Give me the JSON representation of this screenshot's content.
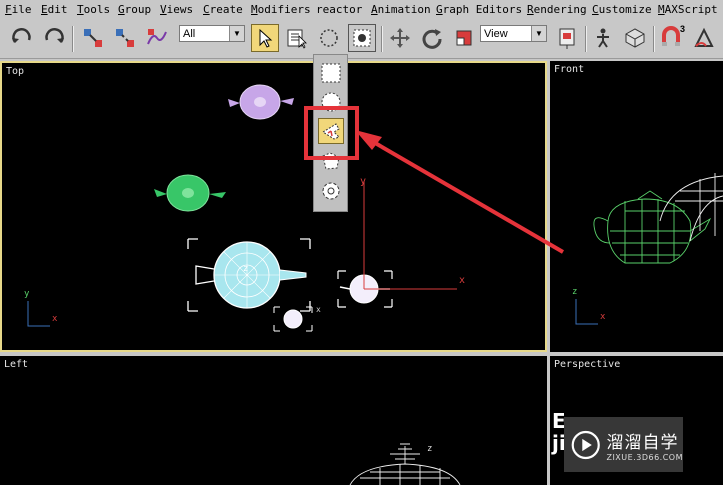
{
  "menu": {
    "items": [
      {
        "label": "File",
        "ul": "F"
      },
      {
        "label": "Edit",
        "ul": "E"
      },
      {
        "label": "Tools",
        "ul": "T"
      },
      {
        "label": "Group",
        "ul": "G"
      },
      {
        "label": "Views",
        "ul": "V"
      },
      {
        "label": "Create",
        "ul": "C"
      },
      {
        "label": "Modifiers",
        "ul": "M"
      },
      {
        "label": "reactor",
        "ul": ""
      },
      {
        "label": "Animation",
        "ul": "A"
      },
      {
        "label": "Graph Editors",
        "ul": "G"
      },
      {
        "label": "Rendering",
        "ul": "R"
      },
      {
        "label": "Customize",
        "ul": "C"
      },
      {
        "label": "MAXScript",
        "ul": "M"
      }
    ]
  },
  "toolbar": {
    "filter_value": "All",
    "coord_value": "View",
    "icons": [
      "undo-icon",
      "redo-icon",
      "select-and-link-icon",
      "unlink-icon",
      "bind-space-warp-icon",
      "select-object-icon",
      "select-by-name-icon",
      "selection-region-icon",
      "window-crossing-icon",
      "move-icon",
      "rotate-icon",
      "scale-icon",
      "pivot-center-icon",
      "manipulate-icon",
      "keyboard-shortcut-icon",
      "snaps-toggle-icon",
      "angle-snap-icon"
    ],
    "snap_label": "3"
  },
  "viewports": {
    "top": {
      "label": "Top"
    },
    "front": {
      "label": "Front"
    },
    "left": {
      "label": "Left"
    },
    "perspective": {
      "label": "Perspective"
    }
  },
  "axes": {
    "x": "x",
    "y": "y",
    "z": "z"
  },
  "flyout": {
    "items": [
      "rectangular-region-icon",
      "circular-region-icon",
      "lasso-region-icon",
      "fence-region-icon",
      "paint-region-icon"
    ],
    "selected": "lasso-region-icon"
  },
  "colors": {
    "highlight_border": "#e7d98a",
    "annotation_red": "#e5333a",
    "teapot_purple": "#c7a6e8",
    "teapot_green": "#38c668",
    "teapot_cyan": "#a8e6ee",
    "wire_green": "#59d06a"
  },
  "watermark": {
    "title": "溜溜自学",
    "subtitle": "ZIXUE.3D66.COM",
    "partial_text": "E\nji"
  }
}
